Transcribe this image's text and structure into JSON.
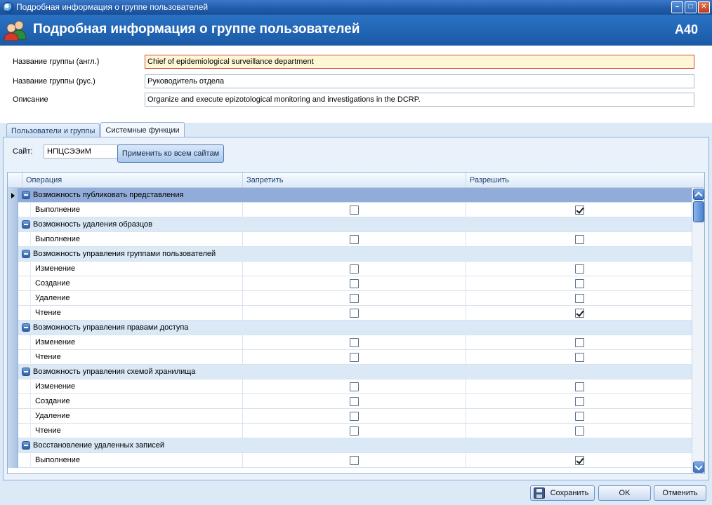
{
  "window": {
    "title": "Подробная информация о группе пользователей",
    "controls": [
      "minimize-icon",
      "maximize-icon",
      "close-icon"
    ]
  },
  "header": {
    "title": "Подробная информация о группе пользователей",
    "code": "A40",
    "icon": "users-icon"
  },
  "form": {
    "name_en_label": "Название группы (англ.)",
    "name_en_value": "Chief of epidemiological surveillance department",
    "name_ru_label": "Название группы (рус.)",
    "name_ru_value": "Руководитель отдела",
    "desc_label": "Описание",
    "desc_value": "Organize and execute epizotological monitoring and investigations in the DCRP."
  },
  "tabs": [
    {
      "label": "Пользователи и группы",
      "active": false
    },
    {
      "label": "Системные функции",
      "active": true
    }
  ],
  "site": {
    "label": "Сайт:",
    "value": "НПЦСЭЭиМ",
    "apply_label": "Применить ко всем сайтам"
  },
  "grid": {
    "columns": [
      "Операция",
      "Запретить",
      "Разрешить"
    ],
    "groups": [
      {
        "name": "Возможность публиковать представления",
        "selected": true,
        "items": [
          {
            "op": "Выполнение",
            "deny": false,
            "allow": true
          }
        ]
      },
      {
        "name": "Возможность удаления образцов",
        "items": [
          {
            "op": "Выполнение",
            "deny": false,
            "allow": false
          }
        ]
      },
      {
        "name": "Возможность управления группами пользователей",
        "items": [
          {
            "op": "Изменение",
            "deny": false,
            "allow": false
          },
          {
            "op": "Создание",
            "deny": false,
            "allow": false
          },
          {
            "op": "Удаление",
            "deny": false,
            "allow": false
          },
          {
            "op": "Чтение",
            "deny": false,
            "allow": true
          }
        ]
      },
      {
        "name": "Возможность управления правами доступа",
        "items": [
          {
            "op": "Изменение",
            "deny": false,
            "allow": false
          },
          {
            "op": "Чтение",
            "deny": false,
            "allow": false
          }
        ]
      },
      {
        "name": "Возможность управления схемой хранилища",
        "items": [
          {
            "op": "Изменение",
            "deny": false,
            "allow": false
          },
          {
            "op": "Создание",
            "deny": false,
            "allow": false
          },
          {
            "op": "Удаление",
            "deny": false,
            "allow": false
          },
          {
            "op": "Чтение",
            "deny": false,
            "allow": false
          }
        ]
      },
      {
        "name": "Восстановление удаленных записей",
        "items": [
          {
            "op": "Выполнение",
            "deny": false,
            "allow": true
          }
        ]
      }
    ]
  },
  "footer": {
    "save_label": "Сохранить",
    "ok_label": "OK",
    "cancel_label": "Отменить"
  },
  "colors": {
    "header_bg": "#1f63b4",
    "selected_row": "#91acd8",
    "group_row": "#dbe8f6",
    "required_field_bg": "#fef7d6",
    "required_field_border": "#d24a3b"
  }
}
